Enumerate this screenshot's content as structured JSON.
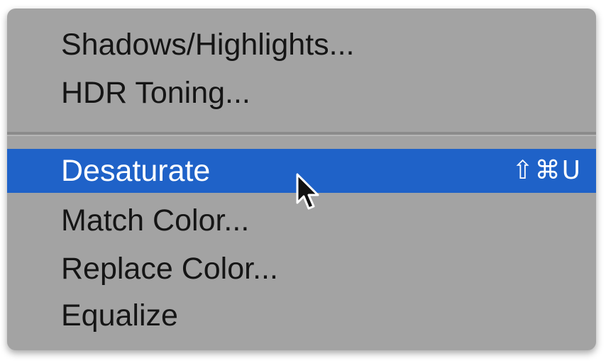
{
  "menu": {
    "group_top": [
      {
        "label": "Shadows/Highlights..."
      },
      {
        "label": "HDR Toning..."
      }
    ],
    "selected_item": {
      "label": "Desaturate",
      "shortcut": "⇧⌘U"
    },
    "group_bottom": [
      {
        "label": "Match Color..."
      },
      {
        "label": "Replace Color..."
      },
      {
        "label": "Equalize"
      }
    ]
  },
  "colors": {
    "menu_background": "#a3a3a3",
    "selection_highlight": "#1f62c8",
    "text": "#151515",
    "selected_text": "#ffffff"
  },
  "icons": {
    "cursor": "arrow-cursor-icon"
  }
}
